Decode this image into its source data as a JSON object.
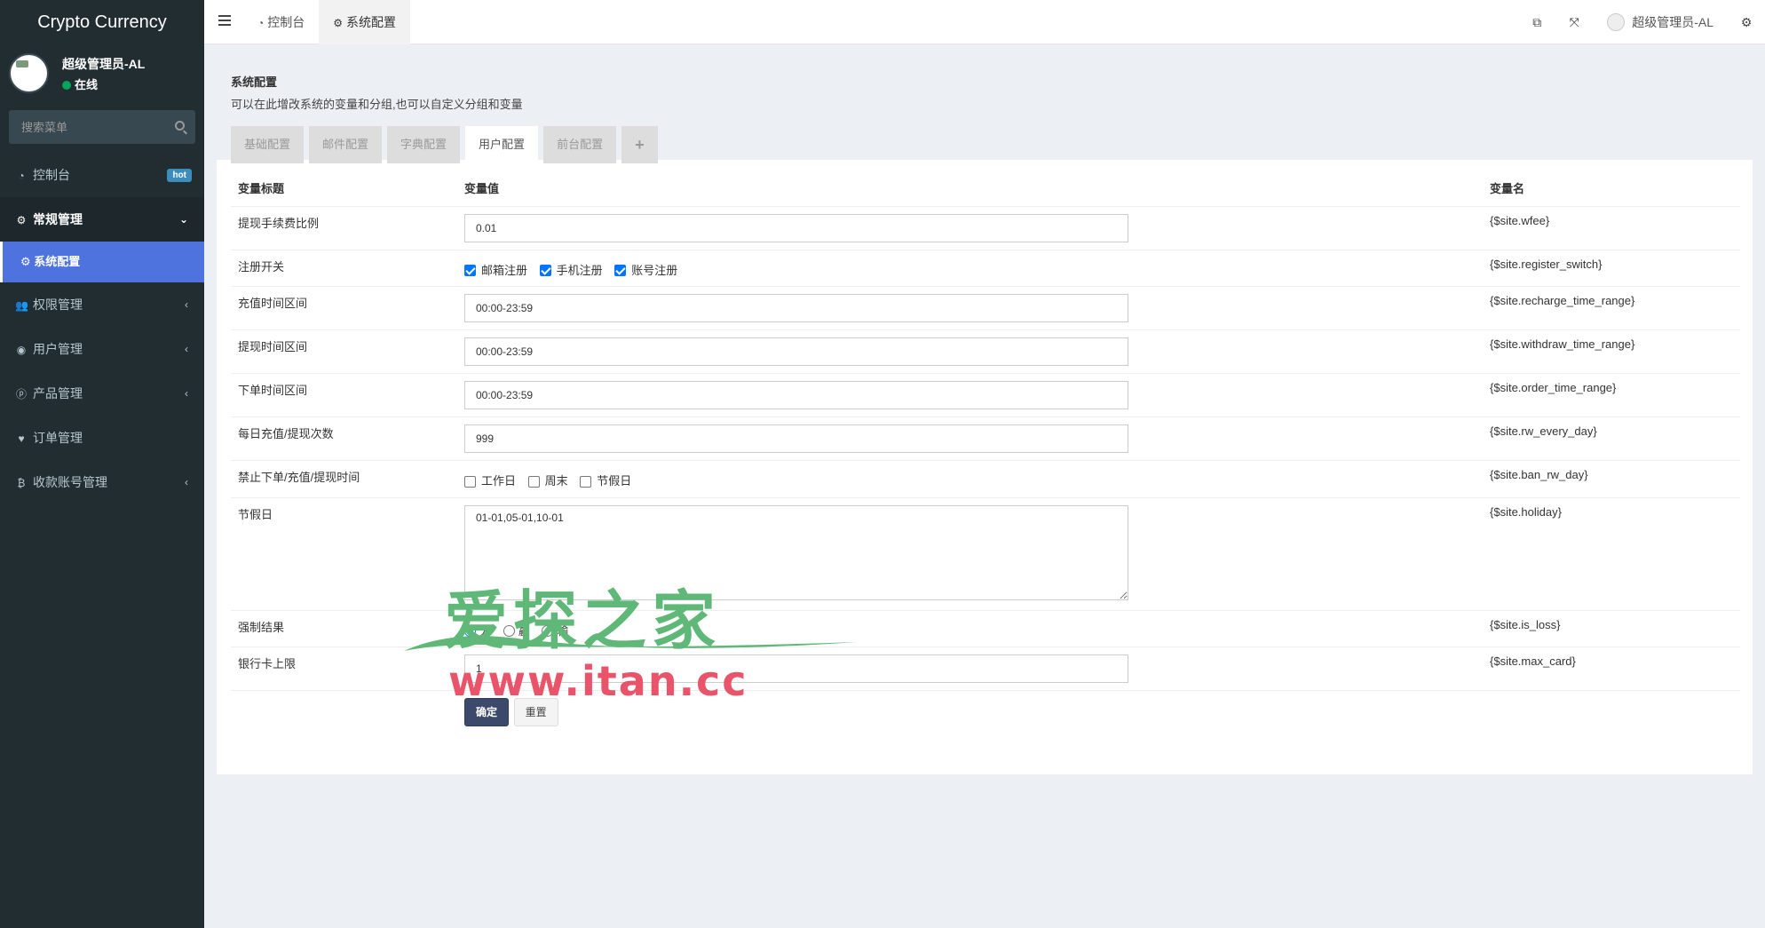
{
  "app": {
    "brand": "Crypto Currency"
  },
  "user": {
    "name": "超级管理员-AL",
    "status": "在线"
  },
  "search": {
    "placeholder": "搜索菜单"
  },
  "sidebar": {
    "items": [
      {
        "label": "控制台",
        "icon": "dashboard-icon",
        "badge": "hot"
      },
      {
        "label": "常规管理",
        "icon": "cogs-icon"
      },
      {
        "label": "系统配置",
        "icon": "gear-icon"
      },
      {
        "label": "权限管理",
        "icon": "users-icon"
      },
      {
        "label": "用户管理",
        "icon": "user-circle-icon"
      },
      {
        "label": "产品管理",
        "icon": "product-icon"
      },
      {
        "label": "订单管理",
        "icon": "heartbeat-icon"
      },
      {
        "label": "收款账号管理",
        "icon": "bitcoin-icon"
      }
    ]
  },
  "topnav": {
    "tabs": [
      {
        "label": "控制台",
        "icon": "dashboard-icon"
      },
      {
        "label": "系统配置",
        "icon": "gear-icon"
      }
    ],
    "user_name": "超级管理员-AL"
  },
  "page": {
    "title": "系统配置",
    "description": "可以在此增改系统的变量和分组,也可以自定义分组和变量",
    "config_tabs": [
      "基础配置",
      "邮件配置",
      "字典配置",
      "用户配置",
      "前台配置",
      "+"
    ],
    "active_tab": "用户配置"
  },
  "table": {
    "headers": {
      "title": "变量标题",
      "value": "变量值",
      "name": "变量名"
    },
    "rows": {
      "wfee": {
        "title": "提现手续费比例",
        "value": "0.01",
        "name": "{$site.wfee}"
      },
      "register": {
        "title": "注册开关",
        "options": [
          "邮箱注册",
          "手机注册",
          "账号注册"
        ],
        "name": "{$site.register_switch}"
      },
      "recharge": {
        "title": "充值时间区间",
        "value": "00:00-23:59",
        "name": "{$site.recharge_time_range}"
      },
      "withdraw": {
        "title": "提现时间区间",
        "value": "00:00-23:59",
        "name": "{$site.withdraw_time_range}"
      },
      "order": {
        "title": "下单时间区间",
        "value": "00:00-23:59",
        "name": "{$site.order_time_range}"
      },
      "rw": {
        "title": "每日充值/提现次数",
        "value": "999",
        "name": "{$site.rw_every_day}"
      },
      "ban": {
        "title": "禁止下单/充值/提现时间",
        "options": [
          "工作日",
          "周末",
          "节假日"
        ],
        "name": "{$site.ban_rw_day}"
      },
      "holiday": {
        "title": "节假日",
        "value": "01-01,05-01,10-01",
        "name": "{$site.holiday}"
      },
      "loss": {
        "title": "强制结果",
        "options": [
          "无",
          "赢",
          "输"
        ],
        "name": "{$site.is_loss}"
      },
      "maxcard": {
        "title": "银行卡上限",
        "value": "1",
        "name": "{$site.max_card}"
      }
    }
  },
  "buttons": {
    "submit": "确定",
    "reset": "重置"
  },
  "watermark": {
    "cn": "爱探之家",
    "url": "www.itan.cc"
  },
  "colors": {
    "sidebar_bg": "#222d32",
    "active_menu": "#4e73df",
    "primary_button": "#3b4a6b",
    "badge": "#3c8dbc"
  }
}
